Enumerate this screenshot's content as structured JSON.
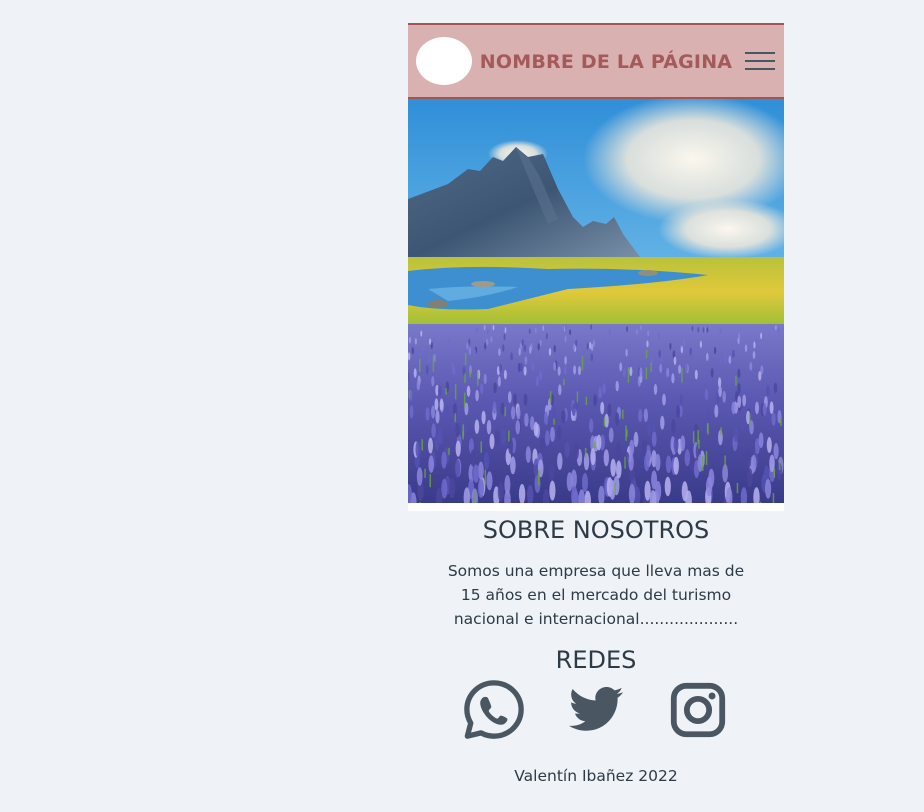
{
  "header": {
    "title": "NOMBRE DE LA PÁGINA",
    "logo_icon": "logo-placeholder-icon",
    "menu_icon": "hamburger-menu-icon"
  },
  "hero": {
    "image_icon": "landscape-mountain-lupine-field-image"
  },
  "about": {
    "title": "SOBRE NOSOTROS",
    "text": "Somos una empresa que lleva mas de 15 años en el mercado del turismo nacional e internacional...................."
  },
  "redes": {
    "title": "REDES",
    "items": [
      {
        "name": "whatsapp",
        "icon": "whatsapp-icon"
      },
      {
        "name": "twitter",
        "icon": "twitter-icon"
      },
      {
        "name": "instagram",
        "icon": "instagram-icon"
      }
    ]
  },
  "footer": {
    "text": "Valentín Ibañez 2022"
  },
  "colors": {
    "background": "#eff3f7",
    "header_bg": "#d8b1b0",
    "header_border": "#a05656",
    "title_color": "#a45a5a",
    "text_color": "#2e3a45",
    "icon_color": "#4a5763"
  }
}
